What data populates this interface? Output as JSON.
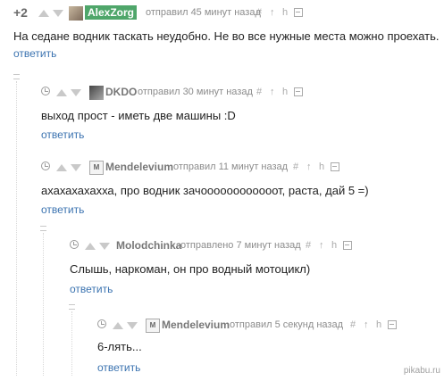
{
  "comments": [
    {
      "rating": "+2",
      "username": "AlexZorg",
      "meta": "отправил 45 минут назад",
      "text": "На седане водник таскать неудобно. Не во все нужные места можно проехать.",
      "reply": "ответить"
    },
    {
      "username": "DKDO",
      "meta": "отправил 30 минут назад",
      "text": "выход прост - иметь две машины :D",
      "reply": "ответить"
    },
    {
      "username": "Mendelevium",
      "meta": "отправил 11 минут назад",
      "text": "ахахахахахха, про водник зачоооооооооооот, раста, дай 5 =)",
      "reply": "ответить"
    },
    {
      "username": "Molodchinka",
      "meta": "отправлено 7 минут назад",
      "text": "Слышь, наркоман, он про водный мотоцикл)",
      "reply": "ответить"
    },
    {
      "username": "Mendelevium",
      "meta": "отправил 5 секунд назад",
      "text": "6-лять...",
      "reply": "ответить"
    }
  ],
  "icons": {
    "hash": "#",
    "up": "↑",
    "parent": "h"
  },
  "watermark": "pikabu.ru",
  "colors": {
    "link": "#3b73b0",
    "username_badge": "#4fa66a",
    "meta": "#8c8c8c"
  }
}
